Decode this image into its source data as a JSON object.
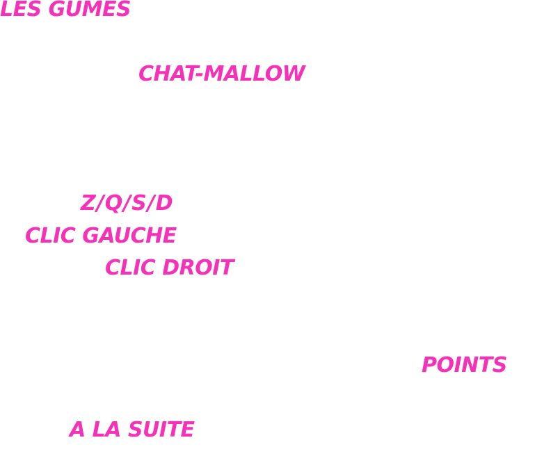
{
  "theme": {
    "text_color": "#f531b7",
    "background": "#ffffff"
  },
  "header": {
    "title": "LES GUMES"
  },
  "intro": {
    "character": "CHAT-MALLOW"
  },
  "controls": {
    "move_keys": "Z/Q/S/D",
    "left_click": "CLIC GAUCHE",
    "right_click": "CLIC DROIT"
  },
  "score": {
    "label": "POINTS"
  },
  "footer": {
    "continue_label": "A LA SUITE"
  }
}
